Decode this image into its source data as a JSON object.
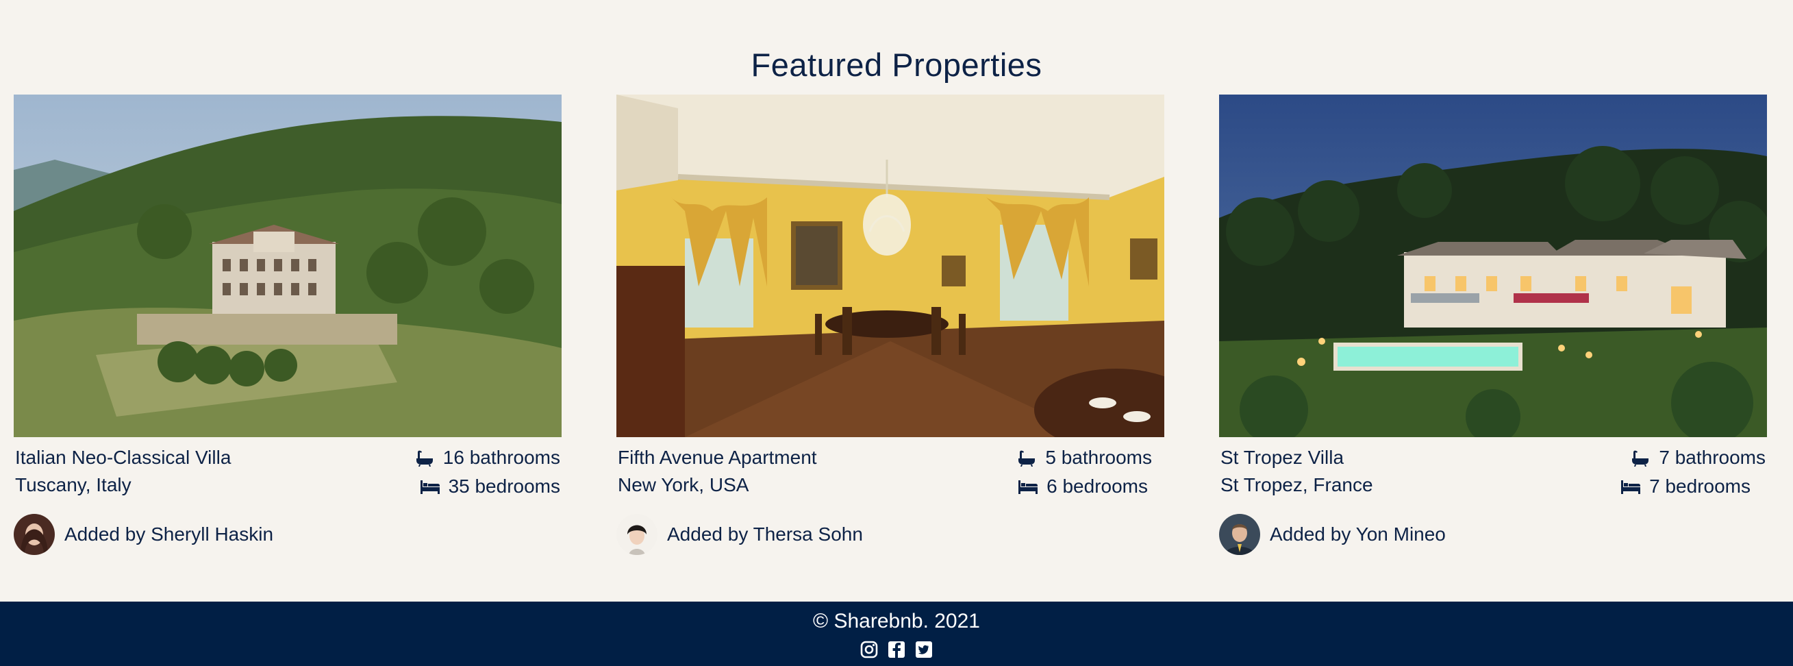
{
  "section": {
    "title": "Featured Properties"
  },
  "properties": [
    {
      "name": "Italian Neo-Classical Villa",
      "location": "Tuscany, Italy",
      "bathrooms": "16 bathrooms",
      "bedrooms": "35 bedrooms",
      "owner": "Added by Sheryll Haskin",
      "photo_icon": "villa-photo"
    },
    {
      "name": "Fifth Avenue Apartment",
      "location": "New York, USA",
      "bathrooms": "5 bathrooms",
      "bedrooms": "6 bedrooms",
      "owner": "Added by Thersa Sohn",
      "photo_icon": "apartment-photo"
    },
    {
      "name": "St Tropez Villa",
      "location": "St Tropez, France",
      "bathrooms": "7 bathrooms",
      "bedrooms": "7 bedrooms",
      "owner": "Added by Yon Mineo",
      "photo_icon": "villa-photo"
    }
  ],
  "footer": {
    "copyright": "© Sharebnb. 2021",
    "socials": [
      "instagram-icon",
      "facebook-icon",
      "twitter-icon"
    ]
  },
  "colors": {
    "navy": "#011f45",
    "background": "#f6f3ee",
    "text": "#0d2246"
  }
}
